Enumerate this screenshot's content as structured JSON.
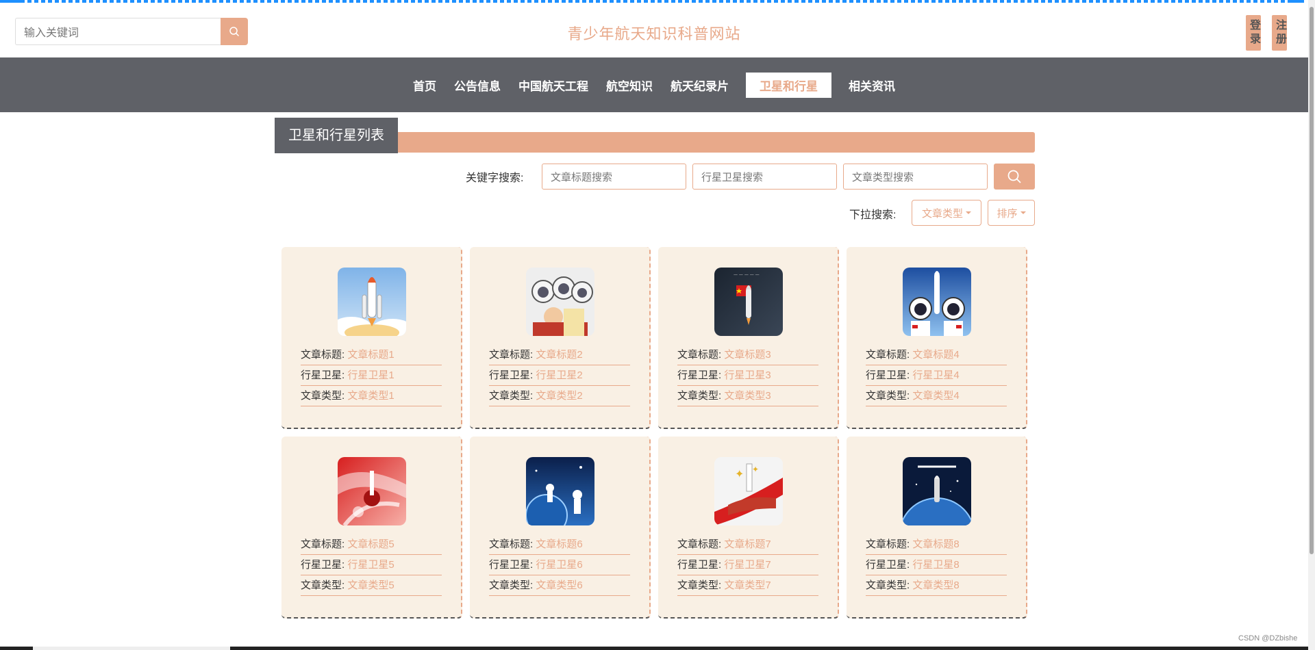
{
  "header": {
    "search_placeholder": "输入关键词",
    "site_title": "青少年航天知识科普网站",
    "login_label": "登录",
    "register_label": "注册"
  },
  "nav": {
    "items": [
      "首页",
      "公告信息",
      "中国航天工程",
      "航空知识",
      "航天纪录片",
      "卫星和行星",
      "相关资讯"
    ],
    "active": "卫星和行星"
  },
  "section": {
    "title": "卫星和行星列表"
  },
  "filters": {
    "keyword_label": "关键字搜索:",
    "title_placeholder": "文章标题搜索",
    "planet_placeholder": "行星卫星搜索",
    "type_placeholder": "文章类型搜索",
    "dropdown_label": "下拉搜索:",
    "type_dropdown": "文章类型",
    "sort_dropdown": "排序"
  },
  "cards": [
    {
      "title_key": "文章标题",
      "title": "文章标题1",
      "planet_key": "行星卫星",
      "planet": "行星卫星1",
      "type_key": "文章类型",
      "type": "文章类型1",
      "image": "shuttle-launch"
    },
    {
      "title_key": "文章标题",
      "title": "文章标题2",
      "planet_key": "行星卫星",
      "planet": "行星卫星2",
      "type_key": "文章类型",
      "type": "文章类型2",
      "image": "astronaut-crowd"
    },
    {
      "title_key": "文章标题",
      "title": "文章标题3",
      "planet_key": "行星卫星",
      "planet": "行星卫星3",
      "type_key": "文章类型",
      "type": "文章类型3",
      "image": "rocket-flag"
    },
    {
      "title_key": "文章标题",
      "title": "文章标题4",
      "planet_key": "行星卫星",
      "planet": "行星卫星4",
      "type_key": "文章类型",
      "type": "文章类型4",
      "image": "astronauts-rocket"
    },
    {
      "title_key": "文章标题",
      "title": "文章标题5",
      "planet_key": "行星卫星",
      "planet": "行星卫星5",
      "type_key": "文章类型",
      "type": "文章类型5",
      "image": "red-abstract"
    },
    {
      "title_key": "文章标题",
      "title": "文章标题6",
      "planet_key": "行星卫星",
      "planet": "行星卫星6",
      "type_key": "文章类型",
      "type": "文章类型6",
      "image": "astronauts-space"
    },
    {
      "title_key": "文章标题",
      "title": "文章标题7",
      "planet_key": "行星卫星",
      "planet": "行星卫星7",
      "type_key": "文章类型",
      "type": "文章类型7",
      "image": "red-ribbon"
    },
    {
      "title_key": "文章标题",
      "title": "文章标题8",
      "planet_key": "行星卫星",
      "planet": "行星卫星8",
      "type_key": "文章类型",
      "type": "文章类型8",
      "image": "china-dream-rocket"
    }
  ],
  "colors": {
    "accent": "#e8a98a",
    "nav_bg": "#5f6167",
    "card_bg": "#f9f0e4"
  },
  "credit": "CSDN @DZbishe"
}
